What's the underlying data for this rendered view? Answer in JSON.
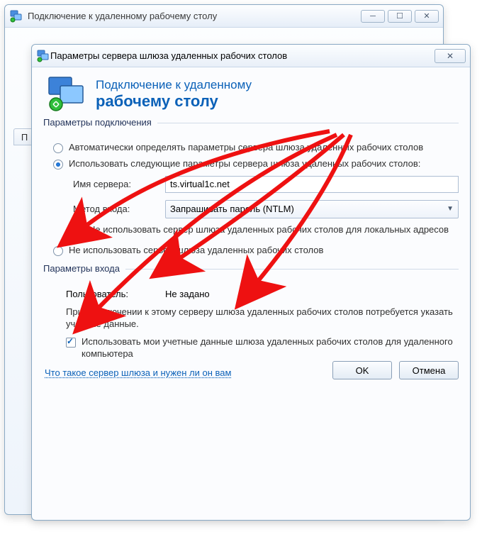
{
  "parent_window": {
    "title": "Подключение к удаленному рабочему столу"
  },
  "child_window": {
    "title": "Параметры сервера шлюза удаленных рабочих столов"
  },
  "app_header": {
    "line1": "Подключение к удаленному",
    "line2": "рабочему столу"
  },
  "tab_fragment": "П",
  "connection_group": {
    "label": "Параметры подключения",
    "radio_auto": "Автоматически определять параметры сервера шлюза удаленных рабочих столов",
    "radio_use": "Использовать следующие параметры сервера шлюза удаленных рабочих столов:",
    "server_label": "Имя сервера:",
    "server_value": "ts.virtual1c.net",
    "method_label": "Метод входа:",
    "method_value": "Запрашивать пароль (NTLM)",
    "check_nolocal": "Не использовать сервер шлюза удаленных рабочих столов для локальных адресов",
    "radio_nouse": "Не использовать сервер шлюза удаленных рабочих столов"
  },
  "login_group": {
    "label": "Параметры входа",
    "user_label": "Пользователь:",
    "user_value": "Не задано",
    "desc": "При подключении к этому серверу шлюза удаленных рабочих столов потребуется указать учетные данные.",
    "check_usecreds": "Использовать мои учетные данные шлюза удаленных рабочих столов для удаленного компьютера"
  },
  "link_whatis": "Что такое сервер шлюза и нужен ли он вам",
  "buttons": {
    "ok": "OK",
    "cancel": "Отмена"
  }
}
